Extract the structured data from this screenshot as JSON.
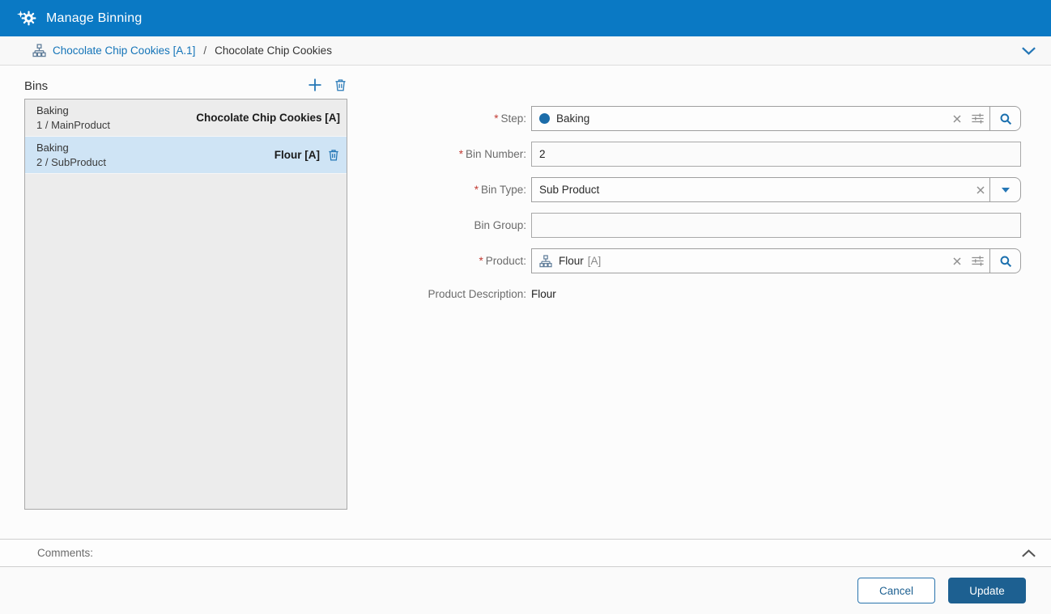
{
  "titlebar": {
    "title": "Manage Binning"
  },
  "breadcrumb": {
    "link": "Chocolate Chip Cookies [A.1]",
    "separator": "/",
    "current": "Chocolate Chip Cookies"
  },
  "bins": {
    "title": "Bins",
    "items": [
      {
        "step": "Baking",
        "detail": "1 / MainProduct",
        "product": "Chocolate Chip Cookies [A]",
        "selected": false
      },
      {
        "step": "Baking",
        "detail": "2 / SubProduct",
        "product": "Flour [A]",
        "selected": true
      }
    ]
  },
  "form": {
    "required_marker": "*",
    "step": {
      "label": "Step:",
      "value": "Baking"
    },
    "bin_number": {
      "label": "Bin Number:",
      "value": "2"
    },
    "bin_type": {
      "label": "Bin Type:",
      "value": "Sub Product"
    },
    "bin_group": {
      "label": "Bin Group:",
      "value": ""
    },
    "product": {
      "label": "Product:",
      "value": "Flour",
      "suffix": "[A]"
    },
    "product_description": {
      "label": "Product Description:",
      "value": "Flour"
    }
  },
  "comments": {
    "label": "Comments:"
  },
  "footer": {
    "cancel": "Cancel",
    "update": "Update"
  },
  "colors": {
    "header_blue": "#0a79c4",
    "accent_blue": "#2577b6",
    "link_blue": "#1474b8",
    "primary_button_blue": "#1d6091",
    "selected_row_blue": "#cfe4f5",
    "panel_gray": "#ececec",
    "required_red": "#c23b33",
    "step_dot_blue": "#1b6ca9"
  }
}
